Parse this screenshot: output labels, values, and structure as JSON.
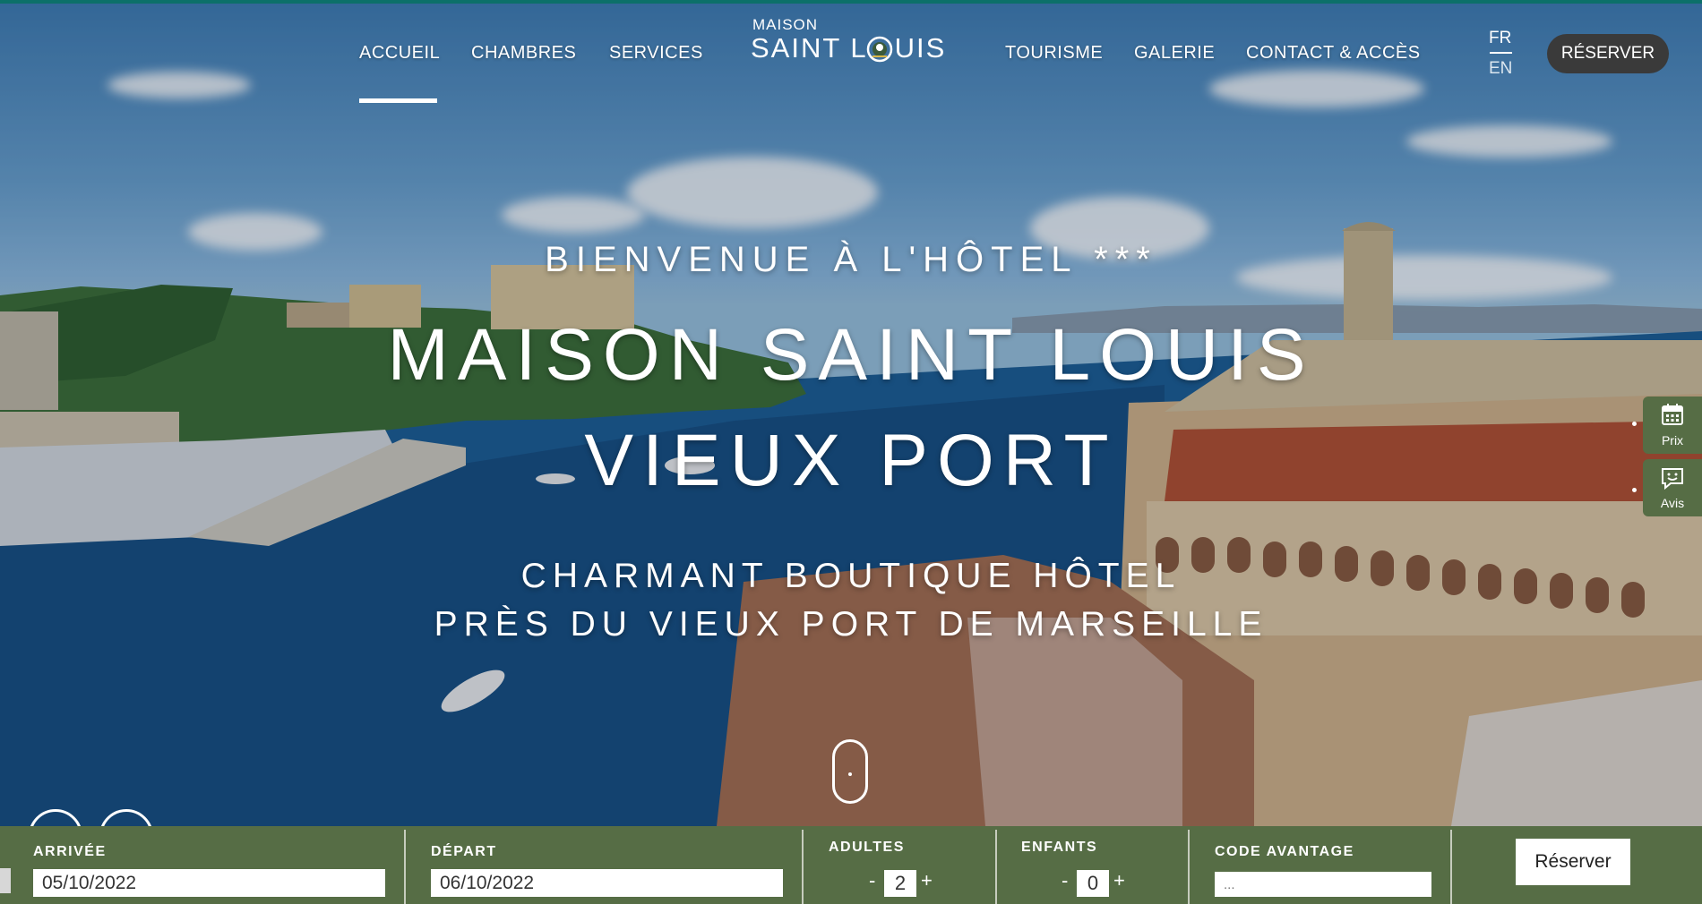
{
  "nav": {
    "items": [
      {
        "label": "ACCUEIL",
        "active": true
      },
      {
        "label": "CHAMBRES"
      },
      {
        "label": "SERVICES"
      },
      {
        "label": "TOURISME"
      },
      {
        "label": "GALERIE"
      },
      {
        "label": "CONTACT & ACCÈS"
      }
    ]
  },
  "logo": {
    "line1": "MAISON",
    "line2": "SAINT L",
    "line2_end": "UIS"
  },
  "language": {
    "fr": "FR",
    "en": "EN",
    "selected": "FR"
  },
  "header": {
    "reserve_label": "RÉSERVER"
  },
  "hero": {
    "welcome": "BIENVENUE À L'HÔTEL ***",
    "title_line1": "MAISON SAINT LOUIS",
    "title_line2": "VIEUX PORT",
    "subtitle_line1": "CHARMANT BOUTIQUE HÔTEL",
    "subtitle_line2": "PRÈS DU VIEUX PORT DE MARSEILLE"
  },
  "side_widgets": {
    "prix": {
      "label": "Prix",
      "icon": "calendar-icon"
    },
    "avis": {
      "label": "Avis",
      "icon": "smiley-chat-icon"
    }
  },
  "booking": {
    "arrival_label": "ARRIVÉE",
    "arrival_value": "05/10/2022",
    "departure_label": "DÉPART",
    "departure_value": "06/10/2022",
    "adults_label": "ADULTES",
    "adults_value": "2",
    "children_label": "ENFANTS",
    "children_value": "0",
    "minus": "-",
    "plus": "+",
    "code_label": "CODE AVANTAGE",
    "code_placeholder": "...",
    "reserve_label": "Réserver"
  },
  "colors": {
    "booking_bar": "#566d45",
    "reserve_pill": "#3a3a3a",
    "top_accent": "#0d8a7a"
  }
}
